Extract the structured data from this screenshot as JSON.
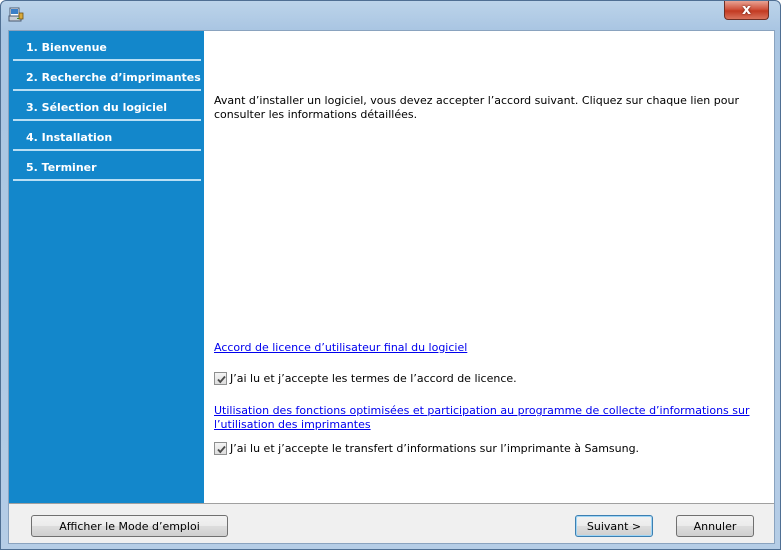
{
  "sidebar": {
    "steps": [
      {
        "label": "1. Bienvenue"
      },
      {
        "label": "2. Recherche d’imprimantes"
      },
      {
        "label": "3. Sélection du logiciel"
      },
      {
        "label": "4. Installation"
      },
      {
        "label": "5. Terminer"
      }
    ]
  },
  "content": {
    "intro": "Avant d’installer un logiciel, vous devez accepter l’accord suivant. Cliquez sur chaque lien pour consulter les informations détaillées.",
    "license_link": "Accord de licence d’utilisateur final du logiciel",
    "license_check": "J’ai lu et j’accepte les termes de l’accord de licence.",
    "license_checked": true,
    "data_link": "Utilisation des fonctions optimisées et participation au programme de collecte d’informations sur l’utilisation des imprimantes",
    "data_check": "J’ai lu et j’accepte le transfert d’informations sur l’imprimante à Samsung.",
    "data_checked": true
  },
  "footer": {
    "manual_button": "Afficher le Mode d’emploi",
    "next_button": "Suivant >",
    "cancel_button": "Annuler"
  },
  "titlebar": {
    "close_glyph": "x"
  },
  "icons": {
    "app": "installer-icon",
    "close": "close-icon",
    "check": "checkmark-icon"
  }
}
